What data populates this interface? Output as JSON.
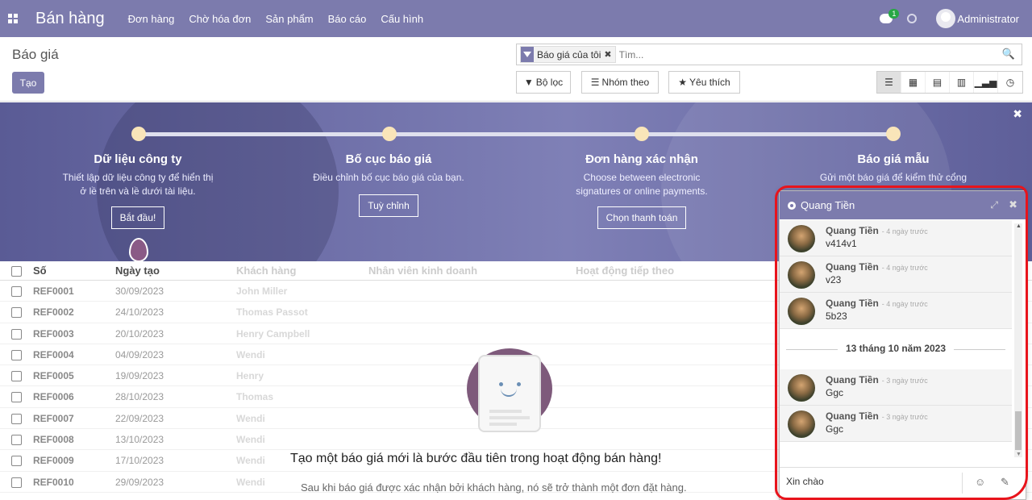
{
  "navbar": {
    "brand": "Bán hàng",
    "menu": [
      "Đơn hàng",
      "Chờ hóa đơn",
      "Sản phẩm",
      "Báo cáo",
      "Cấu hình"
    ],
    "chat_badge": "1",
    "user": "Administrator"
  },
  "control_panel": {
    "title": "Báo giá",
    "create_label": "Tạo",
    "facet_label": "Báo giá của tôi",
    "search_placeholder": "Tìm...",
    "filter_label": "Bộ lọc",
    "group_label": "Nhóm theo",
    "favorite_label": "Yêu thích"
  },
  "banner": {
    "steps": [
      {
        "title": "Dữ liệu công ty",
        "desc1": "Thiết lập dữ liệu công ty để hiển thị",
        "desc2": "ở lề trên và lề dưới tài liệu.",
        "button": "Bắt đầu!"
      },
      {
        "title": "Bố cục báo giá",
        "desc1": "Điều chỉnh bố cục báo giá của bạn.",
        "desc2": "",
        "button": "Tuỳ chỉnh"
      },
      {
        "title": "Đơn hàng xác nhận",
        "desc1": "Choose between electronic",
        "desc2": "signatures or online payments.",
        "button": "Chọn thanh toán"
      },
      {
        "title": "Báo giá mẫu",
        "desc1": "Gửi một báo giá để kiểm thử cổng",
        "desc2": "",
        "button": ""
      }
    ]
  },
  "list": {
    "headers": {
      "number": "Số",
      "date": "Ngày tạo",
      "customer": "Khách hàng",
      "salesperson": "Nhân viên kinh doanh",
      "next_activity": "Hoạt động tiếp theo"
    },
    "rows": [
      {
        "ref": "REF0001",
        "date": "30/09/2023",
        "customer": "John Miller"
      },
      {
        "ref": "REF0002",
        "date": "24/10/2023",
        "customer": "Thomas Passot"
      },
      {
        "ref": "REF0003",
        "date": "20/10/2023",
        "customer": "Henry Campbell"
      },
      {
        "ref": "REF0004",
        "date": "04/09/2023",
        "customer": "Wendi"
      },
      {
        "ref": "REF0005",
        "date": "19/09/2023",
        "customer": "Henry"
      },
      {
        "ref": "REF0006",
        "date": "28/10/2023",
        "customer": "Thomas"
      },
      {
        "ref": "REF0007",
        "date": "22/09/2023",
        "customer": "Wendi"
      },
      {
        "ref": "REF0008",
        "date": "13/10/2023",
        "customer": "Wendi"
      },
      {
        "ref": "REF0009",
        "date": "17/10/2023",
        "customer": "Wendi"
      },
      {
        "ref": "REF0010",
        "date": "29/09/2023",
        "customer": "Wendi"
      }
    ]
  },
  "empty_state": {
    "title": "Tạo một báo giá mới là bước đầu tiên trong hoạt động bán hàng!",
    "subtitle": "Sau khi báo giá được xác nhận bởi khách hàng, nó sẽ trở thành một đơn đặt hàng."
  },
  "chat": {
    "partner": "Quang Tiền",
    "messages_before": [
      {
        "author": "Quang Tiền",
        "time": "- 4 ngày trước",
        "text": "v414v1"
      },
      {
        "author": "Quang Tiền",
        "time": "- 4 ngày trước",
        "text": "v23"
      },
      {
        "author": "Quang Tiền",
        "time": "- 4 ngày trước",
        "text": "5b23"
      }
    ],
    "date_separator": "13 tháng 10 năm 2023",
    "messages_after": [
      {
        "author": "Quang Tiền",
        "time": "- 3 ngày trước",
        "text": "Ggc"
      },
      {
        "author": "Quang Tiền",
        "time": "- 3 ngày trước",
        "text": "Ggc"
      }
    ],
    "compose_value": "Xin chào"
  },
  "colors": {
    "brand": "#7c7bad",
    "annotation": "#e8141c"
  }
}
